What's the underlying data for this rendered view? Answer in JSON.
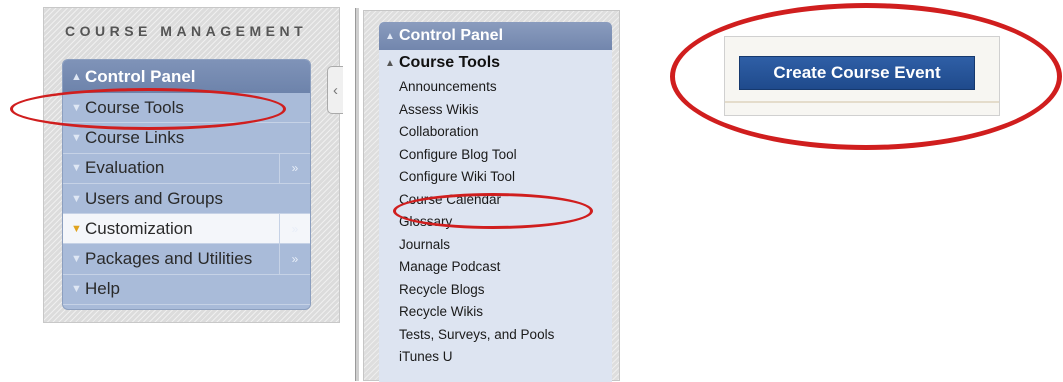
{
  "course_management": {
    "heading": "COURSE MANAGEMENT",
    "control_panel": {
      "title": "Control Panel",
      "items": [
        {
          "label": "Course Tools",
          "expandable": false,
          "selected": false
        },
        {
          "label": "Course Links",
          "expandable": false,
          "selected": false
        },
        {
          "label": "Evaluation",
          "expandable": true,
          "selected": false
        },
        {
          "label": "Users and Groups",
          "expandable": false,
          "selected": false
        },
        {
          "label": "Customization",
          "expandable": true,
          "selected": true
        },
        {
          "label": "Packages and Utilities",
          "expandable": true,
          "selected": false
        },
        {
          "label": "Help",
          "expandable": false,
          "selected": false
        }
      ]
    },
    "collapse_glyph": "‹"
  },
  "expanded_panel": {
    "title": "Control Panel",
    "section_title": "Course Tools",
    "tools": [
      "Announcements",
      "Assess Wikis",
      "Collaboration",
      "Configure Blog Tool",
      "Configure Wiki Tool",
      "Course Calendar",
      "Glossary",
      "Journals",
      "Manage Podcast",
      "Recycle Blogs",
      "Recycle Wikis",
      "Tests, Surveys, and Pools",
      "iTunes U"
    ]
  },
  "calendar_page": {
    "create_event_label": "Create Course Event"
  },
  "icons": {
    "collapse": "chevron-double-up-icon",
    "expand": "chevron-double-down-icon",
    "submenu": "chevron-double-right-icon",
    "panel_toggle": "chevron-left-icon"
  },
  "colors": {
    "annotation_red": "#d01e1e",
    "panel_header": "#7286ad",
    "panel_body": "#a9bbd9",
    "button_blue": "#1f4a8c"
  }
}
